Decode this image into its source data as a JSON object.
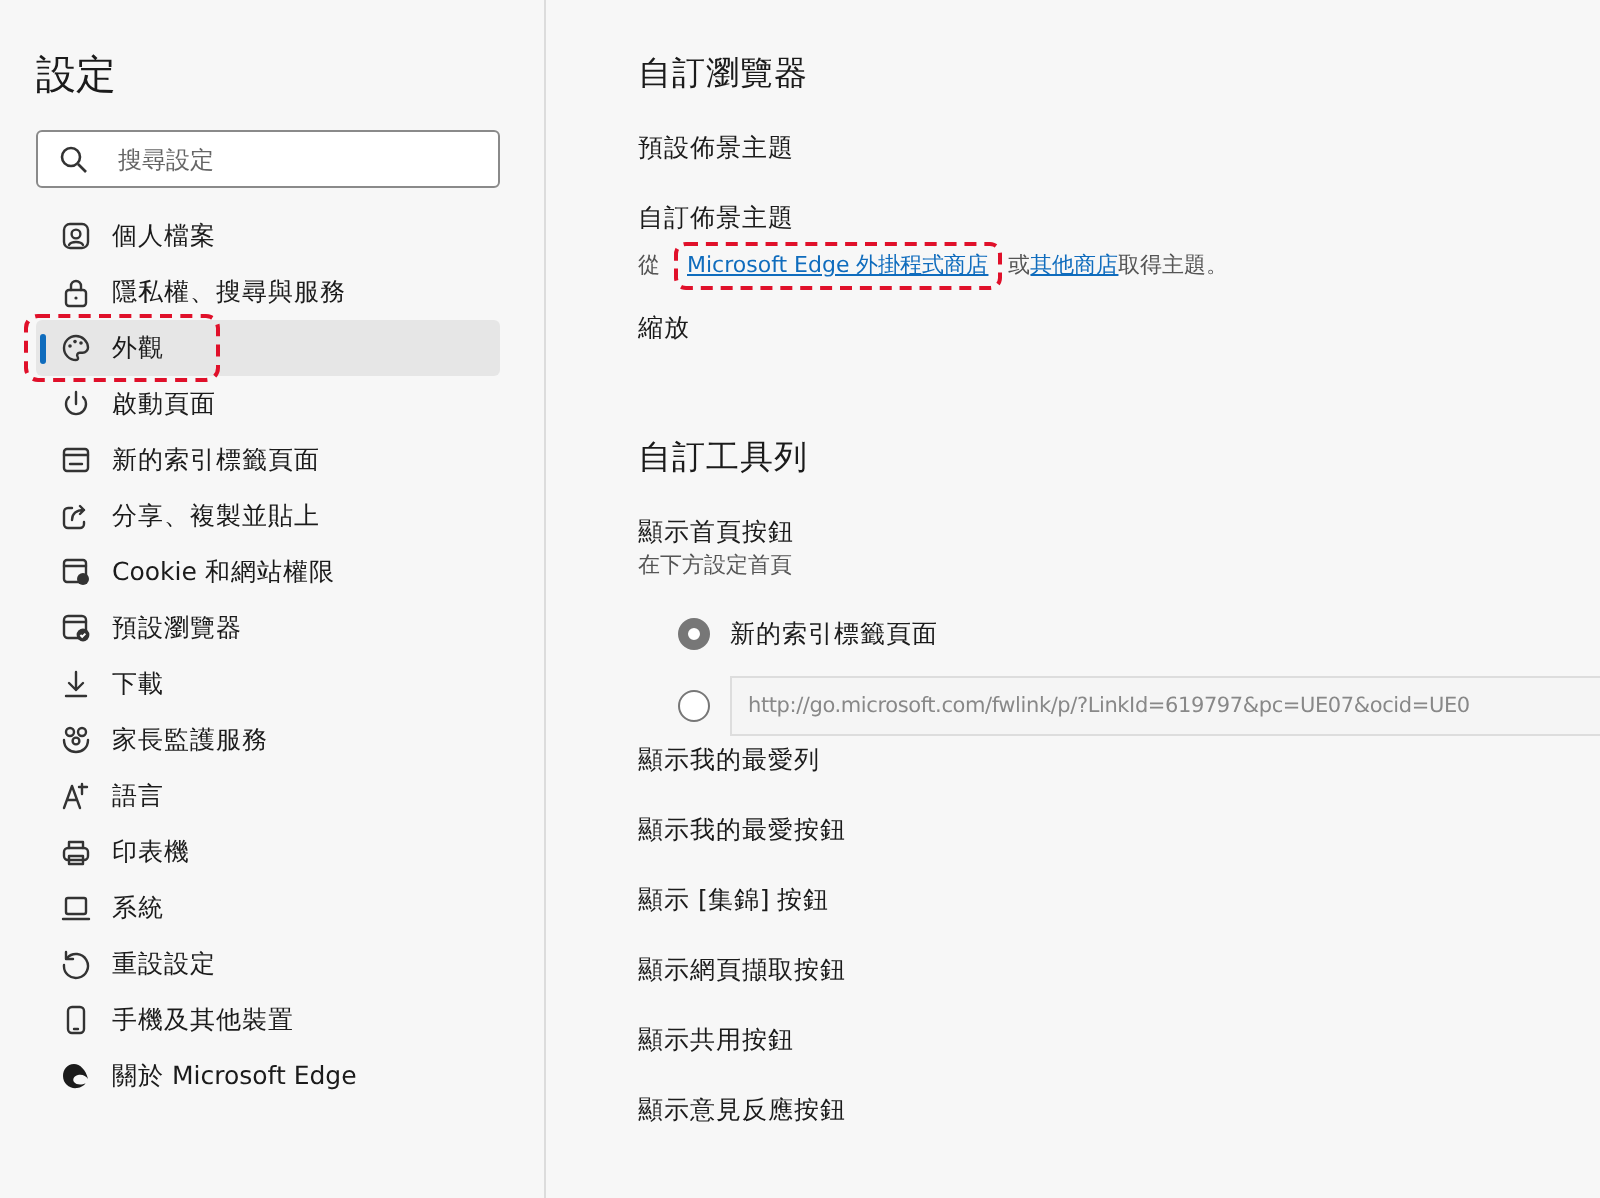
{
  "sidebar": {
    "title": "設定",
    "search": {
      "placeholder": "搜尋設定"
    },
    "items": [
      {
        "label": "個人檔案",
        "selected": false,
        "highlighted": false
      },
      {
        "label": "隱私權、搜尋與服務",
        "selected": false,
        "highlighted": false
      },
      {
        "label": "外觀",
        "selected": true,
        "highlighted": true
      },
      {
        "label": "啟動頁面",
        "selected": false,
        "highlighted": false
      },
      {
        "label": "新的索引標籤頁面",
        "selected": false,
        "highlighted": false
      },
      {
        "label": "分享、複製並貼上",
        "selected": false,
        "highlighted": false
      },
      {
        "label": "Cookie 和網站權限",
        "selected": false,
        "highlighted": false
      },
      {
        "label": "預設瀏覽器",
        "selected": false,
        "highlighted": false
      },
      {
        "label": "下載",
        "selected": false,
        "highlighted": false
      },
      {
        "label": "家長監護服務",
        "selected": false,
        "highlighted": false
      },
      {
        "label": "語言",
        "selected": false,
        "highlighted": false
      },
      {
        "label": "印表機",
        "selected": false,
        "highlighted": false
      },
      {
        "label": "系統",
        "selected": false,
        "highlighted": false
      },
      {
        "label": "重設設定",
        "selected": false,
        "highlighted": false
      },
      {
        "label": "手機及其他裝置",
        "selected": false,
        "highlighted": false
      },
      {
        "label": "關於 Microsoft Edge",
        "selected": false,
        "highlighted": false
      }
    ]
  },
  "main": [
    {
      "kind": "heading",
      "text": "自訂瀏覽器"
    },
    {
      "kind": "setting",
      "text": "預設佈景主題"
    },
    {
      "kind": "setting",
      "text": "自訂佈景主題",
      "description": [
        {
          "text": "從 "
        },
        {
          "text": "Microsoft Edge 外掛程式商店",
          "link": true,
          "highlighted": true
        },
        {
          "text": "或"
        },
        {
          "text": "其他商店",
          "link": true,
          "highlighted": false
        },
        {
          "text": "取得主題。"
        }
      ]
    },
    {
      "kind": "setting",
      "text": "縮放"
    },
    {
      "kind": "heading",
      "text": "自訂工具列"
    },
    {
      "kind": "setting",
      "text": "顯示首頁按鈕",
      "note": "在下方設定首頁"
    },
    {
      "kind": "radio",
      "text": "新的索引標籤頁面",
      "selected": true
    },
    {
      "kind": "radio",
      "value": "http://go.microsoft.com/fwlink/p/?LinkId=619797&pc=UE07&ocid=UE0",
      "selected": false
    },
    {
      "kind": "setting",
      "text": "顯示我的最愛列"
    },
    {
      "kind": "setting",
      "text": "顯示我的最愛按鈕"
    },
    {
      "kind": "setting",
      "text": "顯示 [集錦] 按鈕"
    },
    {
      "kind": "setting",
      "text": "顯示網頁擷取按鈕"
    },
    {
      "kind": "setting",
      "text": "顯示共用按鈕"
    },
    {
      "kind": "setting",
      "text": "顯示意見反應按鈕"
    }
  ]
}
